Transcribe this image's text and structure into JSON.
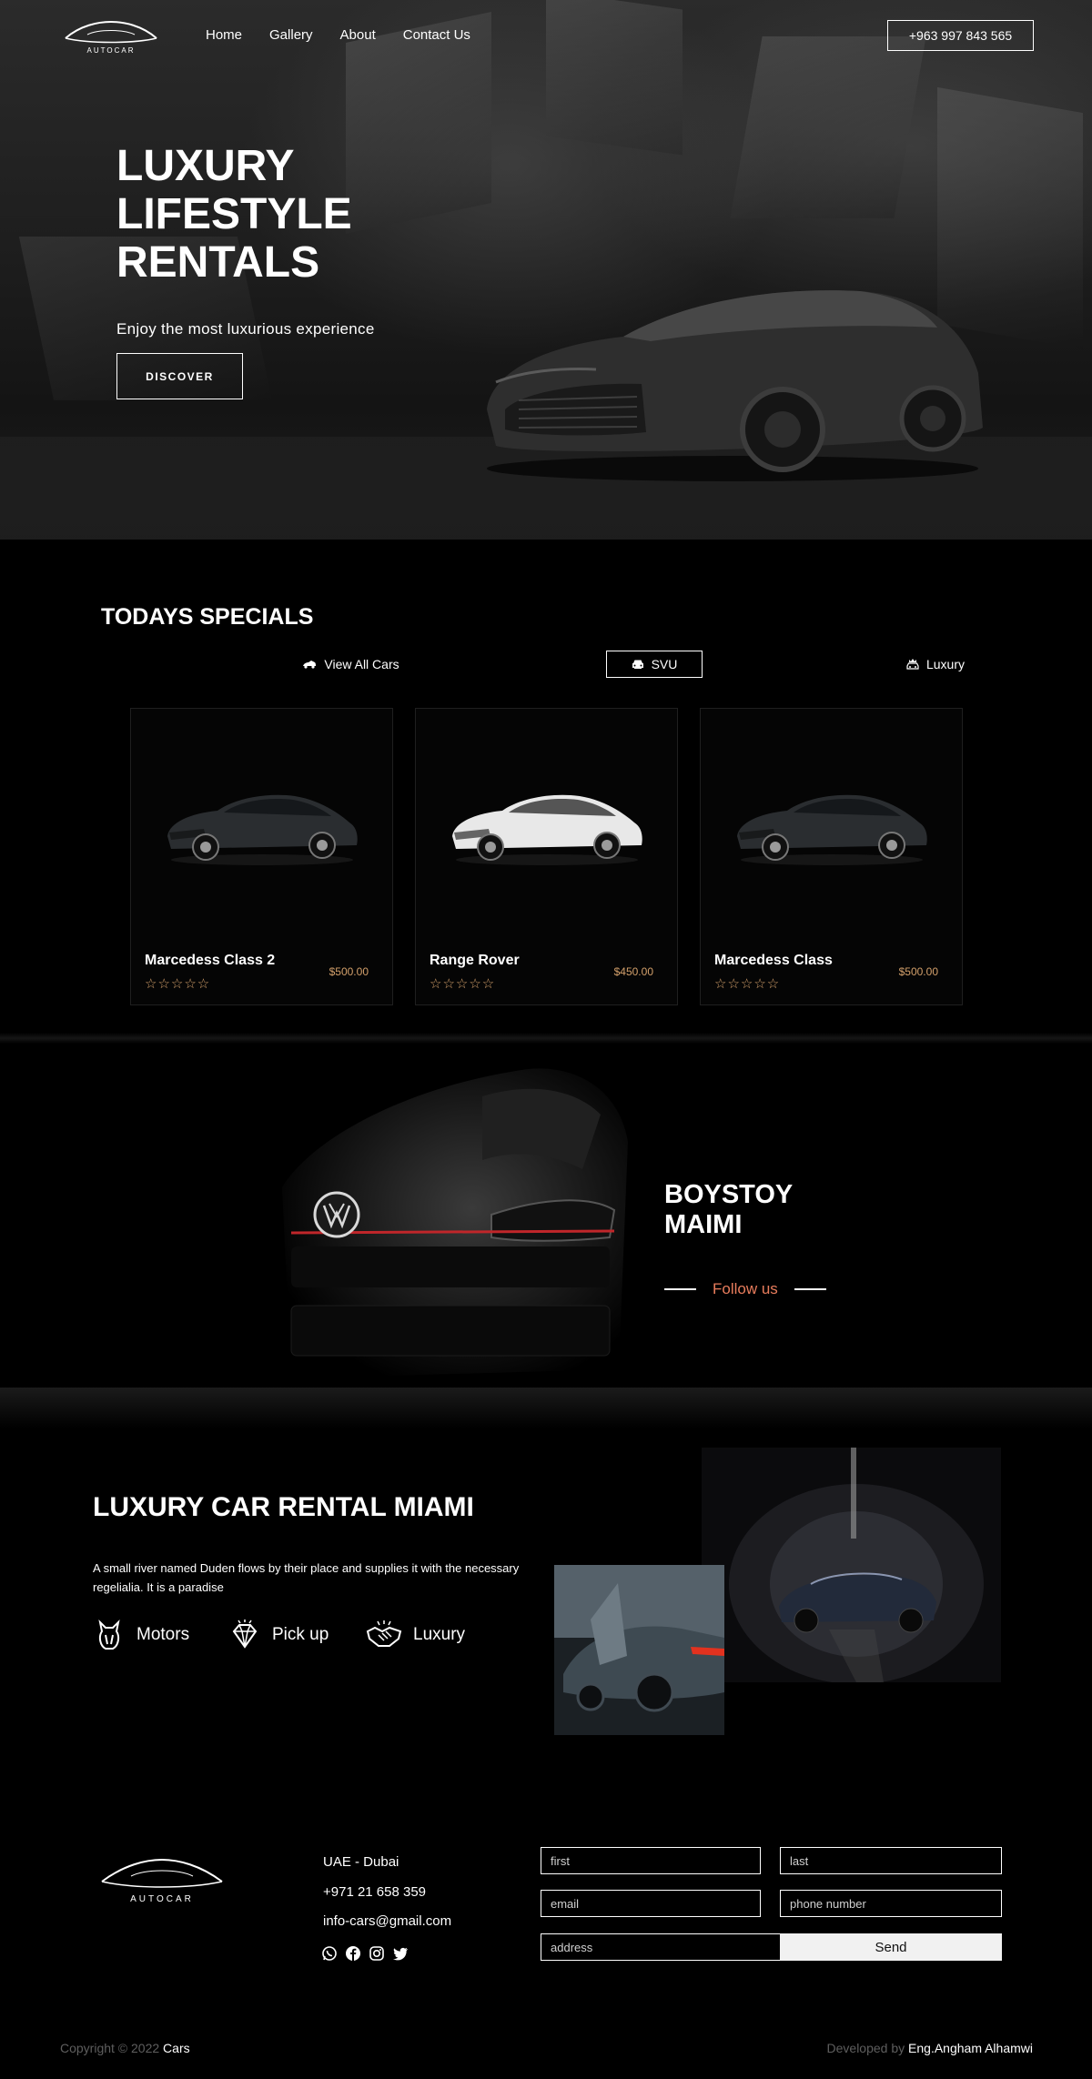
{
  "nav": {
    "logo_text": "AUTOCAR",
    "links": [
      "Home",
      "Gallery",
      "About",
      "Contact Us"
    ],
    "phone": "+963 997 843 565"
  },
  "hero": {
    "title": "LUXURY LIFESTYLE RENTALS",
    "subtitle": "Enjoy the most luxurious experience",
    "cta": "DISCOVER"
  },
  "specials": {
    "title": "TODAYS SPECIALS",
    "filters": [
      {
        "label": "View All Cars",
        "icon": "car-icon",
        "active": false
      },
      {
        "label": "SVU",
        "icon": "car-front-icon",
        "active": true
      },
      {
        "label": "Luxury",
        "icon": "luxury-car-icon",
        "active": false
      }
    ],
    "cards": [
      {
        "name": "Marcedess Class 2",
        "price": "$500.00",
        "stars": "☆☆☆☆☆",
        "car_color": "#2a2d30"
      },
      {
        "name": "Range Rover",
        "price": "$450.00",
        "stars": "☆☆☆☆☆",
        "car_color": "#e8e8e8"
      },
      {
        "name": "Marcedess Class",
        "price": "$500.00",
        "stars": "☆☆☆☆☆",
        "car_color": "#2a2d30"
      }
    ]
  },
  "boystoy": {
    "title_line1": "BOYSTOY",
    "title_line2": "MAIMI",
    "follow": "Follow us"
  },
  "rental": {
    "title": "LUXURY CAR RENTAL MIAMI",
    "description": "A small river named Duden flows by their place and supplies it with the necessary regelialia. It is a paradise",
    "features": [
      {
        "label": "Motors",
        "icon": "horse-head-icon"
      },
      {
        "label": "Pick up",
        "icon": "diamond-icon"
      },
      {
        "label": "Luxury",
        "icon": "handshake-icon"
      }
    ]
  },
  "footer": {
    "logo_text": "AUTOCAR",
    "location": "UAE - Dubai",
    "phone": "+971 21 658 359",
    "email": "info-cars@gmail.com",
    "form": {
      "first_placeholder": "first",
      "last_placeholder": "last",
      "email_placeholder": "email",
      "phone_placeholder": "phone number",
      "address_placeholder": "address",
      "send": "Send"
    },
    "copyright_prefix": "Copyright © 2022",
    "copyright_brand": "Cars",
    "dev_prefix": "Developed by",
    "dev_name": "Eng.Angham Alhamwi"
  },
  "colors": {
    "accent_gold": "#d3a06b",
    "follow_orange": "#e87c5c"
  }
}
